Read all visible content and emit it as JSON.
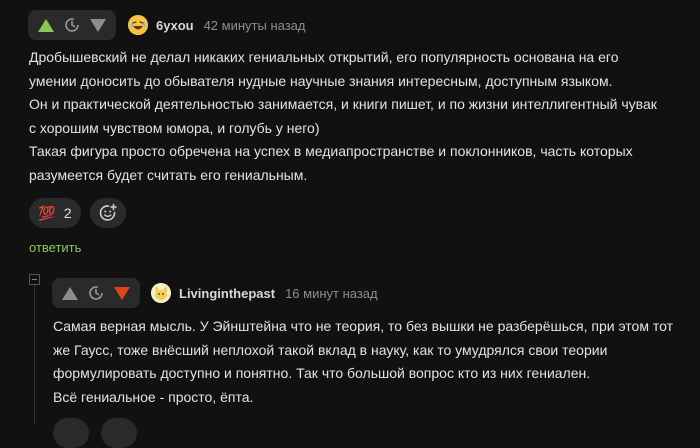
{
  "comment1": {
    "author": "6yxou",
    "time": "42 минуты назад",
    "lines": [
      "Дробышевский не делал никаких гениальных открытий, его популярность основана на его",
      "умении доносить до обывателя нудные научные знания интересным, доступным языком.",
      "Он и практической деятельностью занимается, и книги пишет, и по жизни интеллигентный чувак",
      "с хорошим чувством юмора, и голубь у него)",
      "Такая фигура просто обречена на успех в медиапространстве и поклонников, часть которых",
      "разумеется будет считать его гениальным."
    ],
    "reaction_emoji": "💯",
    "reaction_count": "2",
    "reply_label": "ответить"
  },
  "comment2": {
    "author": "Livinginthepast",
    "time": "16 минут назад",
    "lines": [
      "Самая верная мысль. У Эйнштейна что не теория, то без вышки не разберёшься, при этом тот",
      "же Гаусс, тоже внёсший неплохой такой вклад в науку, как то умудрялся свои теории",
      "формулировать доступно и понятно. Так что большой вопрос кто из них гениален.",
      "Всё гениальное - просто, ёпта."
    ]
  },
  "icons": {
    "upvote": "upvote-arrow-icon",
    "downvote": "downvote-arrow-icon",
    "rating_hidden": "clock-icon",
    "add_reaction": "add-reaction-icon",
    "collapse": "minus-icon"
  },
  "colors": {
    "background": "#111111",
    "upvote_active": "#8ac858",
    "downvote_active": "#e0431b",
    "vote_neutral": "#8d8d8d",
    "reply_link": "#8ac858"
  }
}
